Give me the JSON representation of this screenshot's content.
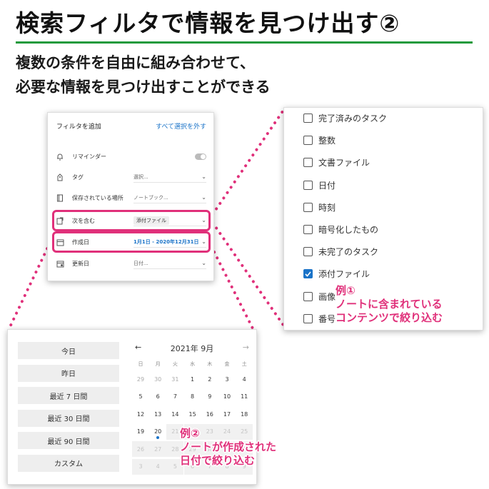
{
  "title": "検索フィルタで情報を見つけ出す②",
  "subtitle_lines": [
    "複数の条件を自由に組み合わせて、",
    "必要な情報を見つけ出すことができる"
  ],
  "filter_panel": {
    "header": "フィルタを追加",
    "deselect_all": "すべて選択を外す",
    "rows": [
      {
        "label": "リマインダー",
        "value": "",
        "icon": "bell-icon"
      },
      {
        "label": "タグ",
        "value": "選択...",
        "icon": "tag-icon"
      },
      {
        "label": "保存されている場所",
        "value": "ノートブック...",
        "icon": "notebook-icon"
      },
      {
        "label": "次を含む",
        "value": "添付ファイル",
        "icon": "contains-icon"
      },
      {
        "label": "作成日",
        "value": "1月1日 - 2020年12月31日",
        "icon": "calendar-icon"
      },
      {
        "label": "更新日",
        "value": "日付...",
        "icon": "calendar-updated-icon"
      }
    ]
  },
  "checklist": {
    "items": [
      {
        "label": "完了済みのタスク",
        "checked": false
      },
      {
        "label": "整数",
        "checked": false
      },
      {
        "label": "文書ファイル",
        "checked": false
      },
      {
        "label": "日付",
        "checked": false
      },
      {
        "label": "時刻",
        "checked": false
      },
      {
        "label": "暗号化したもの",
        "checked": false
      },
      {
        "label": "未完了のタスク",
        "checked": false
      },
      {
        "label": "添付ファイル",
        "checked": true
      },
      {
        "label": "画像",
        "checked": false
      },
      {
        "label": "番号",
        "checked": false
      }
    ]
  },
  "calendar": {
    "presets": [
      "今日",
      "昨日",
      "最近 7 日間",
      "最近 30 日間",
      "最近 90 日間",
      "カスタム"
    ],
    "prev": "←",
    "next": "→",
    "month_label": "2021年 9月",
    "weekdays": [
      "日",
      "月",
      "火",
      "水",
      "木",
      "金",
      "土"
    ],
    "weeks": [
      [
        "29",
        "30",
        "31",
        "1",
        "2",
        "3",
        "4"
      ],
      [
        "5",
        "6",
        "7",
        "8",
        "9",
        "10",
        "11"
      ],
      [
        "12",
        "13",
        "14",
        "15",
        "16",
        "17",
        "18"
      ],
      [
        "19",
        "20",
        "21",
        "22",
        "23",
        "24",
        "25"
      ],
      [
        "26",
        "27",
        "28",
        "29",
        "30",
        "1",
        "2"
      ],
      [
        "3",
        "4",
        "5",
        "6",
        "7",
        "8",
        "9"
      ]
    ]
  },
  "callouts": {
    "one": [
      "例①",
      "ノートに含まれている",
      "コンテンツで絞り込む"
    ],
    "two": [
      "例②",
      "ノートが作成された",
      "日付で絞り込む"
    ]
  },
  "colors": {
    "accent": "#e0307a",
    "rule": "#1e9a3c",
    "link": "#1a73c8"
  }
}
